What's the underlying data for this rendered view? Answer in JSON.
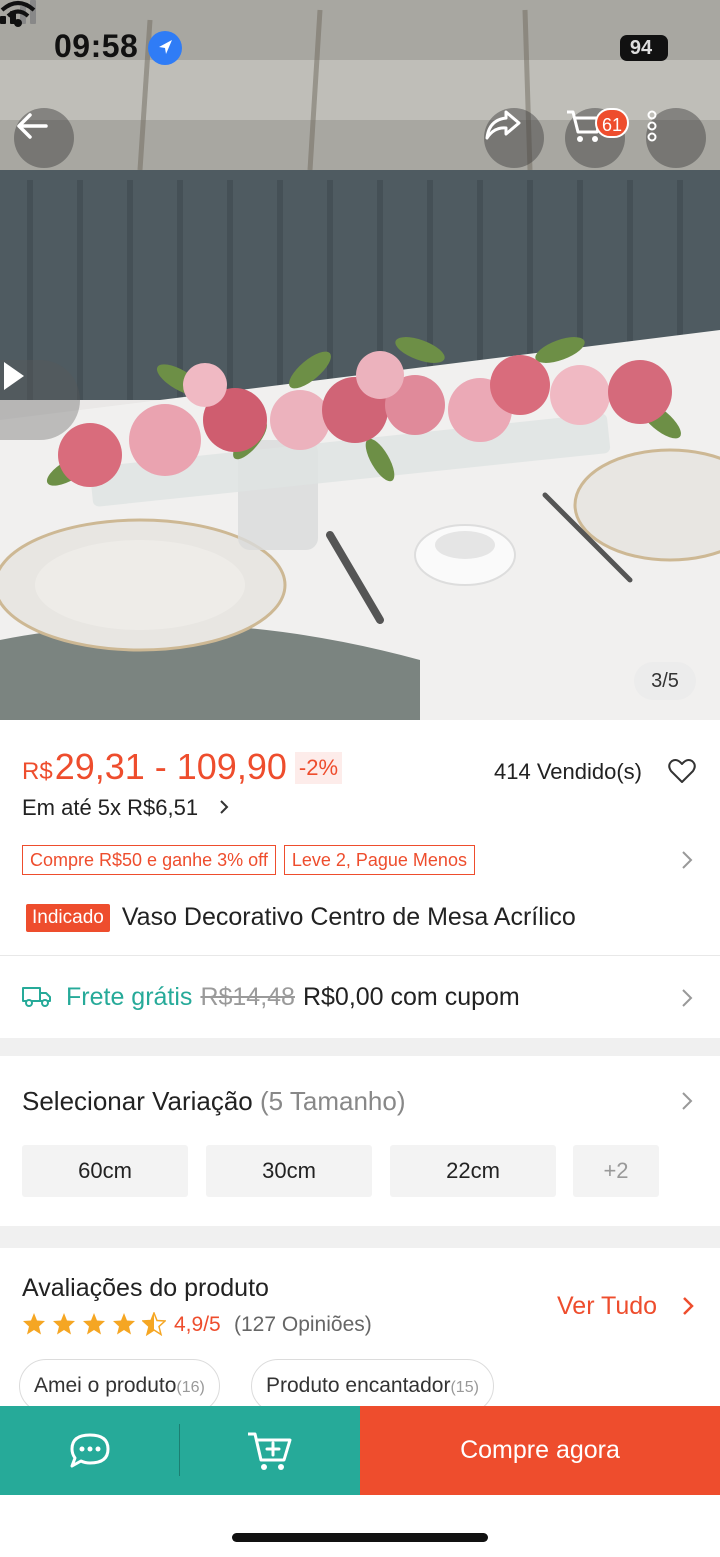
{
  "status_bar": {
    "time": "09:58",
    "battery": "94"
  },
  "gallery": {
    "counter": "3/5"
  },
  "header": {
    "cart_count": "61"
  },
  "price": {
    "currency": "R$",
    "range": "29,31 - 109,90",
    "discount": "-2%",
    "sold": "414 Vendido(s)",
    "installments": "Em até 5x R$6,51"
  },
  "promos": [
    "Compre R$50 e ganhe 3% off",
    "Leve 2, Pague Menos"
  ],
  "product": {
    "tag": "Indicado",
    "title": "Vaso Decorativo Centro de Mesa Acrílico"
  },
  "shipping": {
    "free_label": "Frete grátis",
    "old_price": "R$14,48",
    "cupom_text": "R$0,00 com cupom"
  },
  "variation": {
    "title": "Selecionar Variação",
    "count": "(5 Tamanho)",
    "options": [
      "60cm",
      "30cm",
      "22cm"
    ],
    "more": "+2"
  },
  "reviews": {
    "title": "Avaliações do produto",
    "rating_value": 4.9,
    "rating": "4,9/5",
    "count": "(127 Opiniões)",
    "see_all": "Ver Tudo",
    "chips": [
      {
        "label": "Amei o produto",
        "count": "(16)"
      },
      {
        "label": "Produto encantador",
        "count": "(15)"
      }
    ]
  },
  "bottom_bar": {
    "buy_label": "Compre agora"
  },
  "colors": {
    "brand": "#ee4d2d",
    "teal": "#26aa99"
  }
}
